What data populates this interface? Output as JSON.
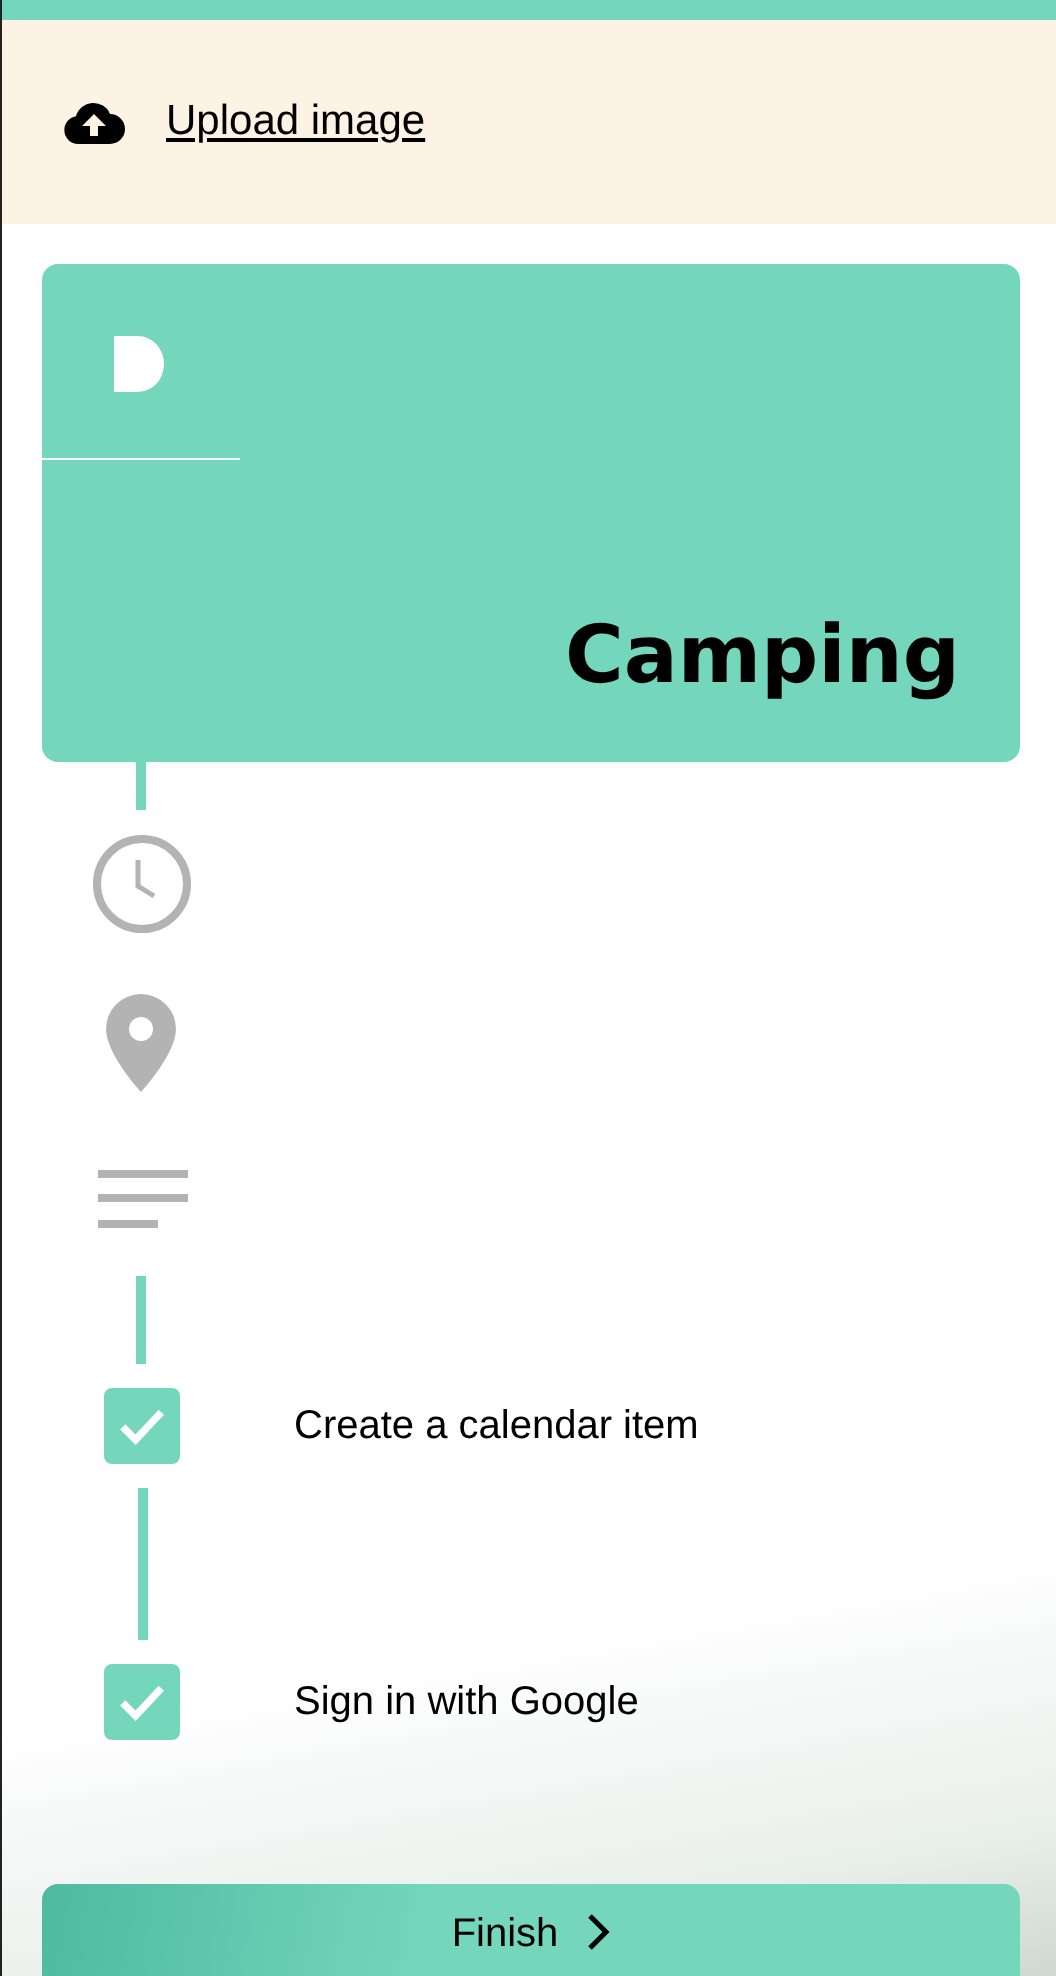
{
  "upload": {
    "label": "Upload image"
  },
  "card": {
    "title": "Camping"
  },
  "tasks": [
    {
      "label": "Create a calendar item",
      "checked": true
    },
    {
      "label": "Sign in with Google",
      "checked": true
    }
  ],
  "finish_button": {
    "label": "Finish"
  }
}
